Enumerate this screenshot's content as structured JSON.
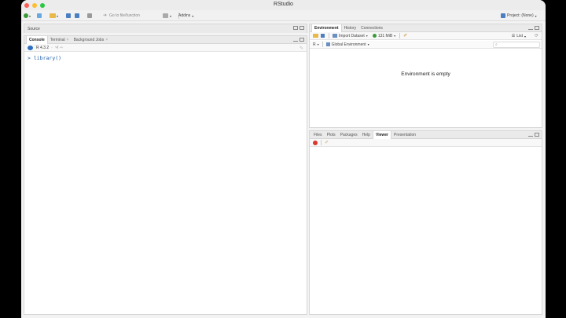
{
  "window": {
    "title": "RStudio"
  },
  "toolbar": {
    "goto_placeholder": "Go to file/function",
    "addins_label": "Addins",
    "project_label": "Project: (None)"
  },
  "source_pane": {
    "title": "Source"
  },
  "console_pane": {
    "tabs": [
      {
        "label": "Console",
        "active": true,
        "closable": false
      },
      {
        "label": "Terminal",
        "active": false,
        "closable": true
      },
      {
        "label": "Background Jobs",
        "active": false,
        "closable": true
      }
    ],
    "r_version": "R 4.3.2",
    "working_dir": "~/",
    "prompt": ">",
    "command": "library()"
  },
  "env_pane": {
    "tabs": [
      {
        "label": "Environment",
        "active": true
      },
      {
        "label": "History",
        "active": false
      },
      {
        "label": "Connections",
        "active": false
      }
    ],
    "import_label": "Import Dataset",
    "memory_label": "131 MiB",
    "list_label": "List",
    "lang_label": "R",
    "scope_label": "Global Environment",
    "empty_message": "Environment is empty"
  },
  "files_pane": {
    "tabs": [
      {
        "label": "Files",
        "active": false
      },
      {
        "label": "Plots",
        "active": false
      },
      {
        "label": "Packages",
        "active": false
      },
      {
        "label": "Help",
        "active": false
      },
      {
        "label": "Viewer",
        "active": true
      },
      {
        "label": "Presentation",
        "active": false
      }
    ]
  },
  "colors": {
    "accent": "#4a90d9",
    "close_red": "#fe5f57",
    "minimize_yellow": "#febc2e",
    "maximize_green": "#28c840",
    "command_blue": "#1c5ea8"
  }
}
